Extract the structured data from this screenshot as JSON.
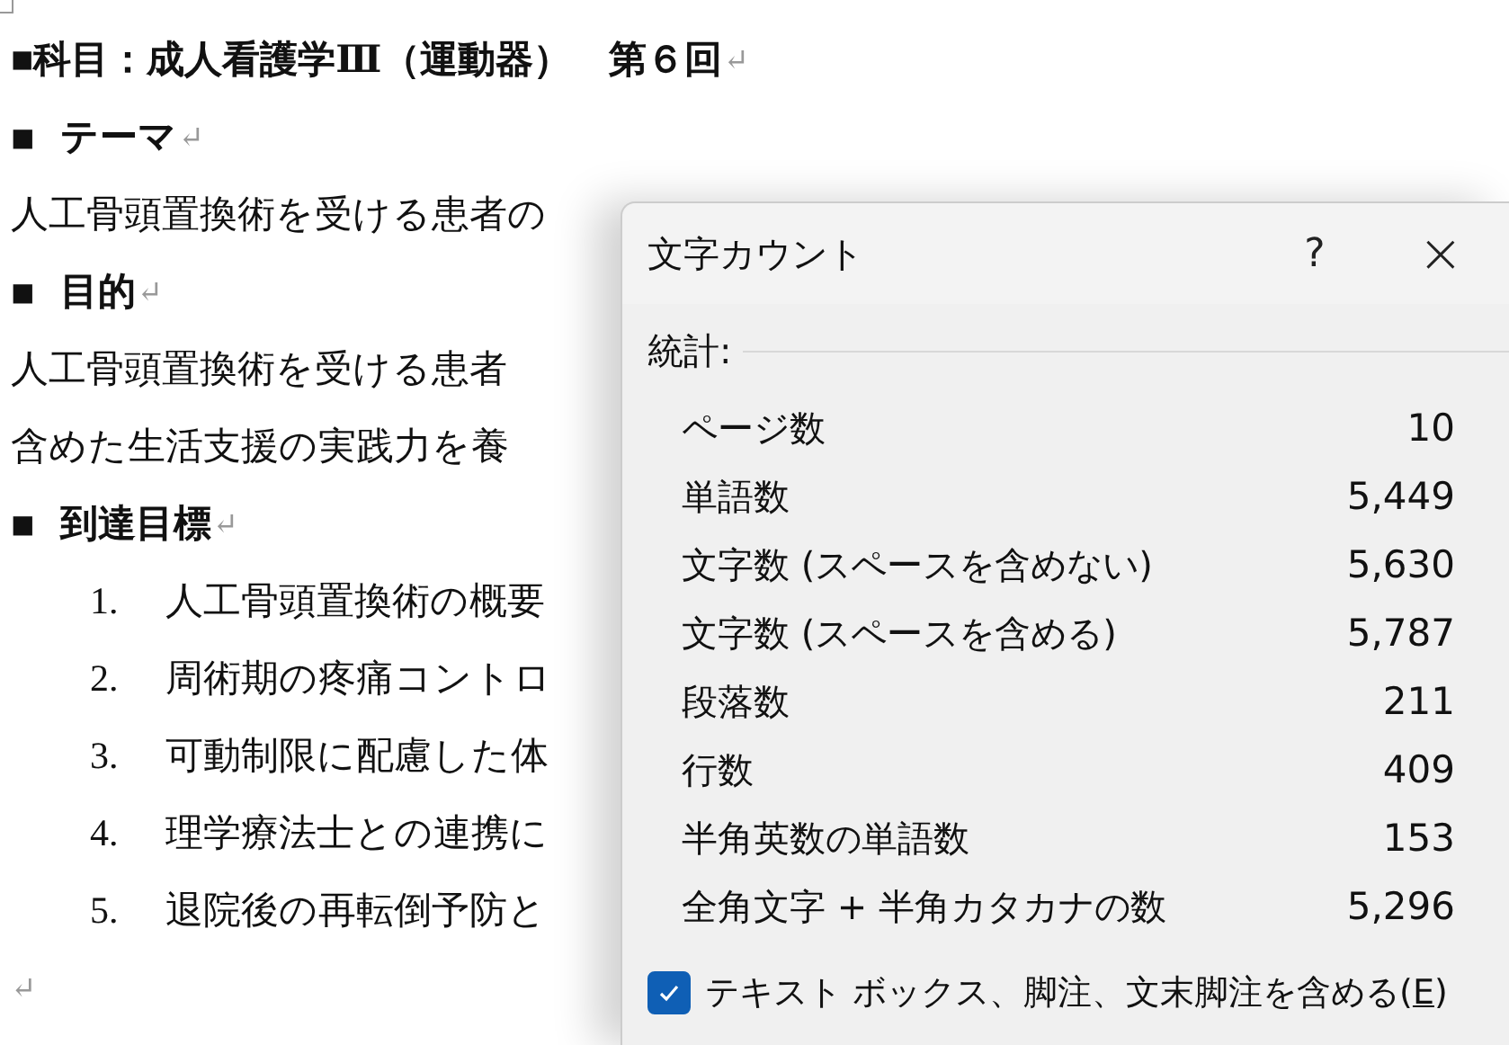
{
  "document": {
    "paragraphs": [
      {
        "kind": "heading",
        "text": "■科目：成人看護学Ⅲ（運動器）　第６回",
        "return_mark": "↵"
      },
      {
        "kind": "section",
        "bullet": "■",
        "text": "テーマ",
        "return_mark": "↵"
      },
      {
        "kind": "body",
        "text": "人工骨頭置換術を受ける患者の"
      },
      {
        "kind": "section",
        "bullet": "■",
        "text": "目的",
        "return_mark": "↵"
      },
      {
        "kind": "body",
        "text": "人工骨頭置換術を受ける患者"
      },
      {
        "kind": "body",
        "text": "含めた生活支援の実践力を養"
      },
      {
        "kind": "section",
        "bullet": "■",
        "text": "到達目標",
        "return_mark": "↵"
      },
      {
        "kind": "item",
        "number": "1.",
        "text": "人工骨頭置換術の概要"
      },
      {
        "kind": "item",
        "number": "2.",
        "text": "周術期の疼痛コントロ"
      },
      {
        "kind": "item",
        "number": "3.",
        "text": "可動制限に配慮した体"
      },
      {
        "kind": "item",
        "number": "4.",
        "text": "理学療法士との連携に"
      },
      {
        "kind": "item",
        "number": "5.",
        "text": "退院後の再転倒予防と"
      },
      {
        "kind": "empty",
        "return_mark": "↵"
      }
    ]
  },
  "dialog": {
    "title": "文字カウント",
    "help": "?",
    "close": "×",
    "section": "統計:",
    "stats": [
      {
        "label": "ページ数",
        "value": "10"
      },
      {
        "label": "単語数",
        "value": "5,449"
      },
      {
        "label": "文字数 (スペースを含めない)",
        "value": "5,630"
      },
      {
        "label": "文字数 (スペースを含める)",
        "value": "5,787"
      },
      {
        "label": "段落数",
        "value": "211"
      },
      {
        "label": "行数",
        "value": "409"
      },
      {
        "label": "半角英数の単語数",
        "value": "153"
      },
      {
        "label": "全角文字 + 半角カタカナの数",
        "value": "5,296"
      }
    ],
    "checkbox": {
      "label_before": "テキスト ボックス、脚注、文末脚注を含める(",
      "access_key": "E",
      "label_after": ")",
      "checked": true
    }
  }
}
